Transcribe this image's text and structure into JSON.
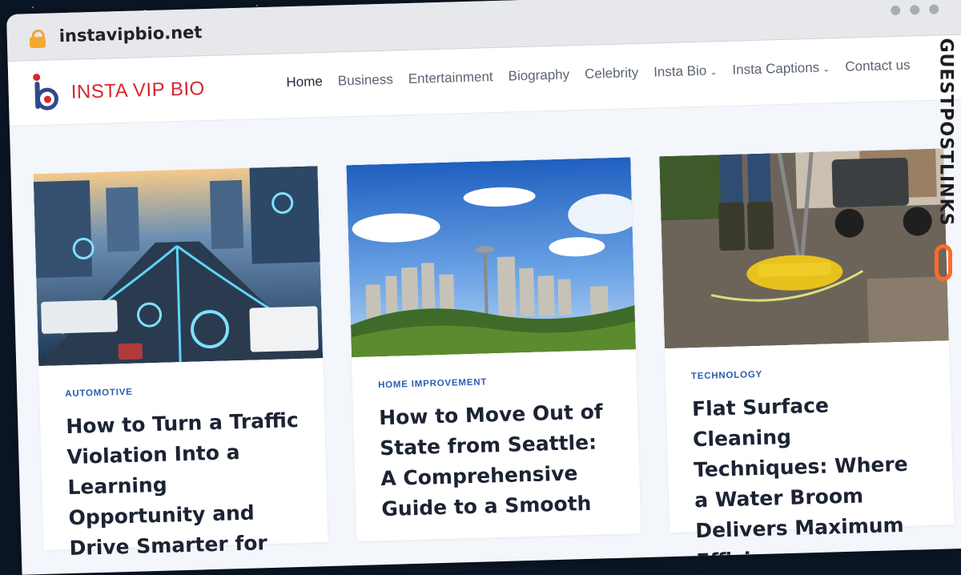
{
  "browser": {
    "url": "instavipbio.net"
  },
  "site": {
    "logo_text": "INSTA VIP BIO",
    "nav": [
      {
        "label": "Home",
        "active": true,
        "dropdown": false
      },
      {
        "label": "Business",
        "active": false,
        "dropdown": false
      },
      {
        "label": "Entertainment",
        "active": false,
        "dropdown": false
      },
      {
        "label": "Biography",
        "active": false,
        "dropdown": false
      },
      {
        "label": "Celebrity",
        "active": false,
        "dropdown": false
      },
      {
        "label": "Insta Bio",
        "active": false,
        "dropdown": true
      },
      {
        "label": "Insta Captions",
        "active": false,
        "dropdown": true
      },
      {
        "label": "Contact us",
        "active": false,
        "dropdown": false
      }
    ]
  },
  "articles": [
    {
      "category": "AUTOMOTIVE",
      "title": "How to Turn a Traffic Violation Into a Learning Opportunity and Drive Smarter for",
      "image": "smart-traffic-image"
    },
    {
      "category": "HOME IMPROVEMENT",
      "title": "How to Move Out of State from Seattle: A Comprehensive Guide to a Smooth",
      "image": "seattle-skyline-image"
    },
    {
      "category": "TECHNOLOGY",
      "title": "Flat Surface Cleaning Techniques: Where a Water Broom Delivers Maximum Efficiency",
      "image": "water-broom-image"
    }
  ],
  "watermark": {
    "text": "GUESTPOSTLINKS"
  },
  "colors": {
    "accent": "#d8262e",
    "logo_blue": "#2f4a8c",
    "category": "#2a5db0",
    "watermark_orange": "#ff6a2c"
  }
}
